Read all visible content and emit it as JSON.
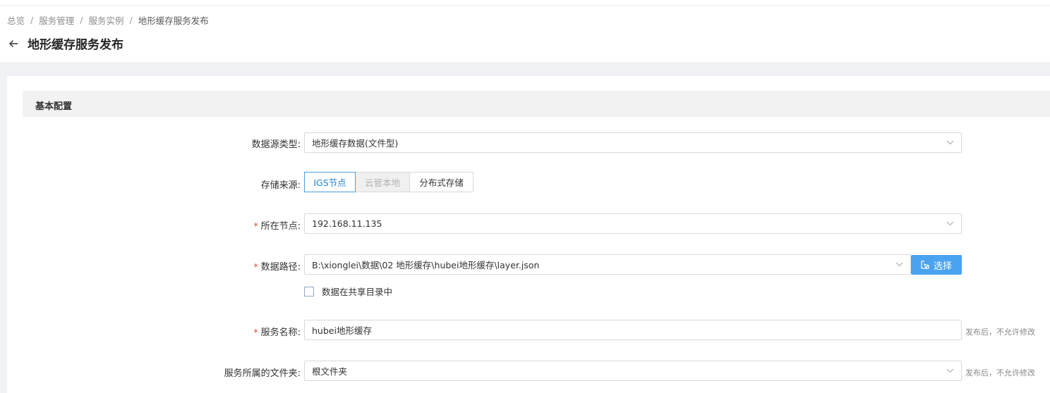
{
  "breadcrumb": {
    "items": [
      "总览",
      "服务管理",
      "服务实例"
    ],
    "current": "地形缓存服务发布",
    "separator": "/"
  },
  "page": {
    "title": "地形缓存服务发布",
    "back_icon": "arrow-left-icon"
  },
  "section": {
    "title": "基本配置"
  },
  "form": {
    "datasource_type": {
      "label": "数据源类型:",
      "value": "地形缓存数据(文件型)"
    },
    "storage_source": {
      "label": "存储来源:",
      "options": [
        "IGS节点",
        "云管本地",
        "分布式存储"
      ],
      "selected": "IGS节点",
      "disabled": "云管本地"
    },
    "node": {
      "label": "所在节点:",
      "required": "*",
      "value": "192.168.11.135"
    },
    "data_path": {
      "label": "数据路径:",
      "required": "*",
      "value": "B:\\xionglei\\数据\\02 地形缓存\\hubei地形缓存\\layer.json",
      "button": "选择"
    },
    "shared_dir": {
      "label": "数据在共享目录中",
      "checked": false
    },
    "service_name": {
      "label": "服务名称:",
      "required": "*",
      "value": "hubei地形缓存",
      "hint": "发布后，不允许修改"
    },
    "folder": {
      "label": "服务所属的文件夹:",
      "value": "根文件夹",
      "hint": "发布后，不允许修改"
    }
  },
  "colors": {
    "accent": "#4aa3f0",
    "active_border": "#4a9fe0",
    "required": "#e8412c",
    "section_bg": "#f2f2f2",
    "page_bg": "#f0f2f5"
  }
}
